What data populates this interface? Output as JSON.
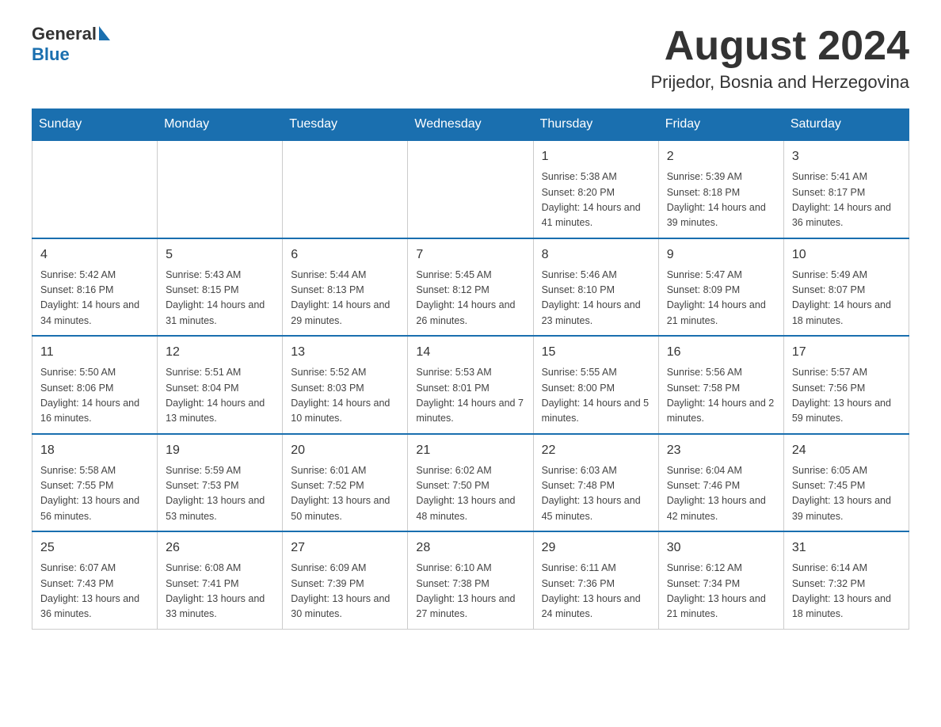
{
  "header": {
    "logo_general": "General",
    "logo_blue": "Blue",
    "month_title": "August 2024",
    "location": "Prijedor, Bosnia and Herzegovina"
  },
  "days_of_week": [
    "Sunday",
    "Monday",
    "Tuesday",
    "Wednesday",
    "Thursday",
    "Friday",
    "Saturday"
  ],
  "weeks": [
    [
      {
        "day": "",
        "info": ""
      },
      {
        "day": "",
        "info": ""
      },
      {
        "day": "",
        "info": ""
      },
      {
        "day": "",
        "info": ""
      },
      {
        "day": "1",
        "info": "Sunrise: 5:38 AM\nSunset: 8:20 PM\nDaylight: 14 hours and 41 minutes."
      },
      {
        "day": "2",
        "info": "Sunrise: 5:39 AM\nSunset: 8:18 PM\nDaylight: 14 hours and 39 minutes."
      },
      {
        "day": "3",
        "info": "Sunrise: 5:41 AM\nSunset: 8:17 PM\nDaylight: 14 hours and 36 minutes."
      }
    ],
    [
      {
        "day": "4",
        "info": "Sunrise: 5:42 AM\nSunset: 8:16 PM\nDaylight: 14 hours and 34 minutes."
      },
      {
        "day": "5",
        "info": "Sunrise: 5:43 AM\nSunset: 8:15 PM\nDaylight: 14 hours and 31 minutes."
      },
      {
        "day": "6",
        "info": "Sunrise: 5:44 AM\nSunset: 8:13 PM\nDaylight: 14 hours and 29 minutes."
      },
      {
        "day": "7",
        "info": "Sunrise: 5:45 AM\nSunset: 8:12 PM\nDaylight: 14 hours and 26 minutes."
      },
      {
        "day": "8",
        "info": "Sunrise: 5:46 AM\nSunset: 8:10 PM\nDaylight: 14 hours and 23 minutes."
      },
      {
        "day": "9",
        "info": "Sunrise: 5:47 AM\nSunset: 8:09 PM\nDaylight: 14 hours and 21 minutes."
      },
      {
        "day": "10",
        "info": "Sunrise: 5:49 AM\nSunset: 8:07 PM\nDaylight: 14 hours and 18 minutes."
      }
    ],
    [
      {
        "day": "11",
        "info": "Sunrise: 5:50 AM\nSunset: 8:06 PM\nDaylight: 14 hours and 16 minutes."
      },
      {
        "day": "12",
        "info": "Sunrise: 5:51 AM\nSunset: 8:04 PM\nDaylight: 14 hours and 13 minutes."
      },
      {
        "day": "13",
        "info": "Sunrise: 5:52 AM\nSunset: 8:03 PM\nDaylight: 14 hours and 10 minutes."
      },
      {
        "day": "14",
        "info": "Sunrise: 5:53 AM\nSunset: 8:01 PM\nDaylight: 14 hours and 7 minutes."
      },
      {
        "day": "15",
        "info": "Sunrise: 5:55 AM\nSunset: 8:00 PM\nDaylight: 14 hours and 5 minutes."
      },
      {
        "day": "16",
        "info": "Sunrise: 5:56 AM\nSunset: 7:58 PM\nDaylight: 14 hours and 2 minutes."
      },
      {
        "day": "17",
        "info": "Sunrise: 5:57 AM\nSunset: 7:56 PM\nDaylight: 13 hours and 59 minutes."
      }
    ],
    [
      {
        "day": "18",
        "info": "Sunrise: 5:58 AM\nSunset: 7:55 PM\nDaylight: 13 hours and 56 minutes."
      },
      {
        "day": "19",
        "info": "Sunrise: 5:59 AM\nSunset: 7:53 PM\nDaylight: 13 hours and 53 minutes."
      },
      {
        "day": "20",
        "info": "Sunrise: 6:01 AM\nSunset: 7:52 PM\nDaylight: 13 hours and 50 minutes."
      },
      {
        "day": "21",
        "info": "Sunrise: 6:02 AM\nSunset: 7:50 PM\nDaylight: 13 hours and 48 minutes."
      },
      {
        "day": "22",
        "info": "Sunrise: 6:03 AM\nSunset: 7:48 PM\nDaylight: 13 hours and 45 minutes."
      },
      {
        "day": "23",
        "info": "Sunrise: 6:04 AM\nSunset: 7:46 PM\nDaylight: 13 hours and 42 minutes."
      },
      {
        "day": "24",
        "info": "Sunrise: 6:05 AM\nSunset: 7:45 PM\nDaylight: 13 hours and 39 minutes."
      }
    ],
    [
      {
        "day": "25",
        "info": "Sunrise: 6:07 AM\nSunset: 7:43 PM\nDaylight: 13 hours and 36 minutes."
      },
      {
        "day": "26",
        "info": "Sunrise: 6:08 AM\nSunset: 7:41 PM\nDaylight: 13 hours and 33 minutes."
      },
      {
        "day": "27",
        "info": "Sunrise: 6:09 AM\nSunset: 7:39 PM\nDaylight: 13 hours and 30 minutes."
      },
      {
        "day": "28",
        "info": "Sunrise: 6:10 AM\nSunset: 7:38 PM\nDaylight: 13 hours and 27 minutes."
      },
      {
        "day": "29",
        "info": "Sunrise: 6:11 AM\nSunset: 7:36 PM\nDaylight: 13 hours and 24 minutes."
      },
      {
        "day": "30",
        "info": "Sunrise: 6:12 AM\nSunset: 7:34 PM\nDaylight: 13 hours and 21 minutes."
      },
      {
        "day": "31",
        "info": "Sunrise: 6:14 AM\nSunset: 7:32 PM\nDaylight: 13 hours and 18 minutes."
      }
    ]
  ]
}
